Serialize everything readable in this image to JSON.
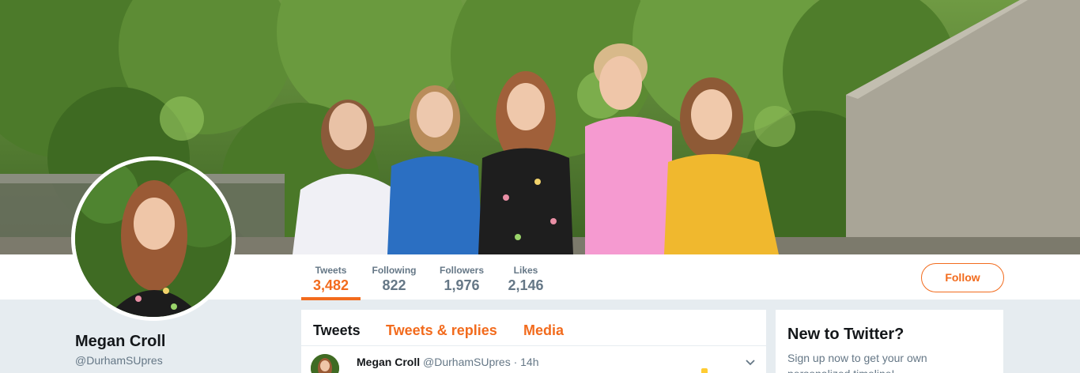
{
  "profile": {
    "name": "Megan Croll",
    "handle": "@DurhamSUpres"
  },
  "nav": {
    "stats": [
      {
        "label": "Tweets",
        "value": "3,482"
      },
      {
        "label": "Following",
        "value": "822"
      },
      {
        "label": "Followers",
        "value": "1,976"
      },
      {
        "label": "Likes",
        "value": "2,146"
      }
    ],
    "follow_label": "Follow"
  },
  "timeline": {
    "tabs": [
      "Tweets",
      "Tweets & replies",
      "Media"
    ],
    "tweet": {
      "name": "Megan Croll",
      "handle": "@DurhamSUpres",
      "time": "· 14h"
    }
  },
  "sidebar": {
    "title": "New to Twitter?",
    "text": "Sign up now to get your own personalized timeline!"
  },
  "colors": {
    "accent": "#f26b1d",
    "background": "#e6ecf0",
    "text_primary": "#14171a",
    "text_secondary": "#657786"
  },
  "icons": {
    "tweet_menu": "chevron-down-icon"
  }
}
